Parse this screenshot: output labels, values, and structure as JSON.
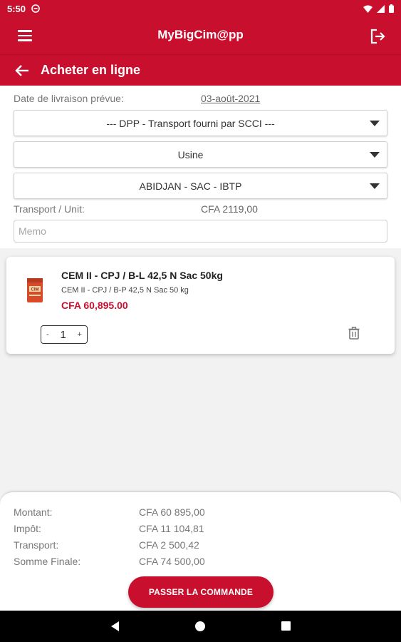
{
  "status_bar": {
    "time": "5:50"
  },
  "app_bar": {
    "title": "MyBigCim@pp"
  },
  "sub_bar": {
    "title": "Acheter en ligne"
  },
  "form": {
    "delivery_label": "Date de livraison prévue:",
    "delivery_date": "03-août-2021",
    "transport_select": "--- DPP - Transport fourni par SCCI ---",
    "origin_select": "Usine",
    "destination_select": "ABIDJAN - SAC - IBTP",
    "transport_unit_label": "Transport / Unit:",
    "transport_unit_value": "CFA  2119,00",
    "memo_placeholder": "Memo"
  },
  "product": {
    "name": "CEM II - CPJ / B-L 42,5 N Sac 50kg",
    "description": "CEM II - CPJ / B-P 42,5 N Sac 50 kg",
    "price": "CFA  60,895.00",
    "image_text": "CIM",
    "quantity": "1",
    "minus": "-",
    "plus": "+"
  },
  "summary": {
    "montant_label": "Montant:",
    "montant_value": "CFA  60 895,00",
    "impot_label": "Impôt:",
    "impot_value": "CFA  11 104,81",
    "transport_label": "Transport:",
    "transport_value": "CFA  2 500,42",
    "final_label": "Somme Finale:",
    "final_value": "CFA  74 500,00",
    "order_button": "PASSER LA COMMANDE"
  },
  "colors": {
    "brand": "#c8102e",
    "background": "#f2f2f2"
  },
  "icons": [
    "menu-icon",
    "logout-icon",
    "back-arrow-icon",
    "dropdown-caret-icon",
    "trash-icon",
    "wifi-icon",
    "signal-icon",
    "battery-icon"
  ]
}
